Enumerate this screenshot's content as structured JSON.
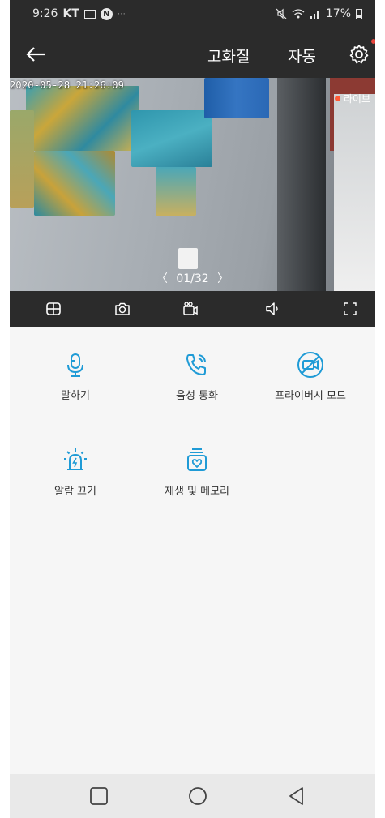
{
  "status_bar": {
    "time": "9:26",
    "carrier": "KT",
    "battery": "17%"
  },
  "header": {
    "quality_label": "고화질",
    "auto_label": "자동"
  },
  "video": {
    "timestamp": "2020-05-28 21:26:09",
    "live_label": "라이브",
    "pager": {
      "prev": "〈",
      "current": "01/32",
      "next": "〉"
    }
  },
  "features": [
    {
      "id": "talk",
      "label": "말하기",
      "icon": "microphone-icon"
    },
    {
      "id": "voice-call",
      "label": "음성 통화",
      "icon": "phone-call-icon"
    },
    {
      "id": "privacy",
      "label": "프라이버시 모드",
      "icon": "camera-off-icon"
    },
    {
      "id": "alarm",
      "label": "알람 끄기",
      "icon": "siren-icon"
    },
    {
      "id": "playback",
      "label": "재생 및 메모리",
      "icon": "playback-memory-icon"
    }
  ],
  "colors": {
    "accent": "#1f9bd6",
    "dark_bar": "#2b2b2b",
    "live_dot": "#ff5a36",
    "settings_dot": "#e8453c"
  }
}
